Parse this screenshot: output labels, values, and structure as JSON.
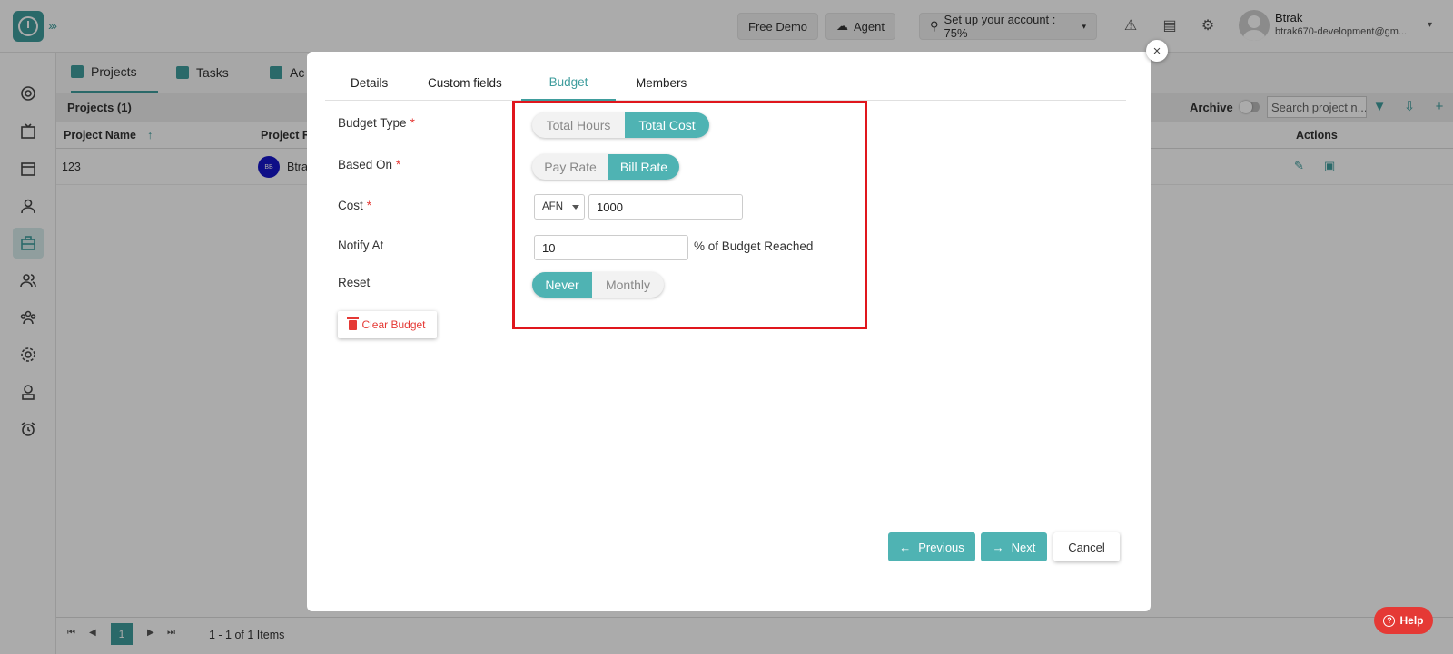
{
  "topbar": {
    "free_demo": "Free Demo",
    "agent": "Agent",
    "setup": "Set up your account : 75%",
    "user_name": "Btrak",
    "user_email": "btrak670-development@gm..."
  },
  "tabs": [
    "Projects",
    "Tasks",
    "Ac"
  ],
  "grid": {
    "title": "Projects (1)",
    "archive_label": "Archive",
    "search_placeholder": "Search project n...",
    "columns": {
      "name": "Project Name",
      "responsible": "Project R",
      "actions": "Actions"
    },
    "row": {
      "name": "123",
      "avatar_initials": "BB",
      "responsible": "Btra"
    },
    "pager_info": "1 - 1 of 1 Items",
    "page": "1"
  },
  "help": "Help",
  "modal": {
    "tabs": [
      "Details",
      "Custom fields",
      "Budget",
      "Members"
    ],
    "active_tab": "Budget",
    "labels": {
      "budget_type": "Budget Type",
      "based_on": "Based On",
      "cost": "Cost",
      "notify_at": "Notify At",
      "reset": "Reset",
      "required": "*"
    },
    "budget_type": {
      "options": [
        "Total Hours",
        "Total Cost"
      ],
      "selected": "Total Cost"
    },
    "based_on": {
      "options": [
        "Pay Rate",
        "Bill Rate"
      ],
      "selected": "Bill Rate"
    },
    "cost": {
      "currency": "AFN",
      "value": "1000"
    },
    "notify_at": {
      "value": "10",
      "suffix": "% of Budget Reached"
    },
    "reset": {
      "options": [
        "Never",
        "Monthly"
      ],
      "selected": "Never"
    },
    "clear_budget": "Clear Budget",
    "buttons": {
      "previous": "Previous",
      "next": "Next",
      "cancel": "Cancel"
    }
  },
  "colors": {
    "accent": "#4fb3b3",
    "brand": "#3f9d9d",
    "highlight": "#e0161d",
    "danger": "#e53935"
  }
}
